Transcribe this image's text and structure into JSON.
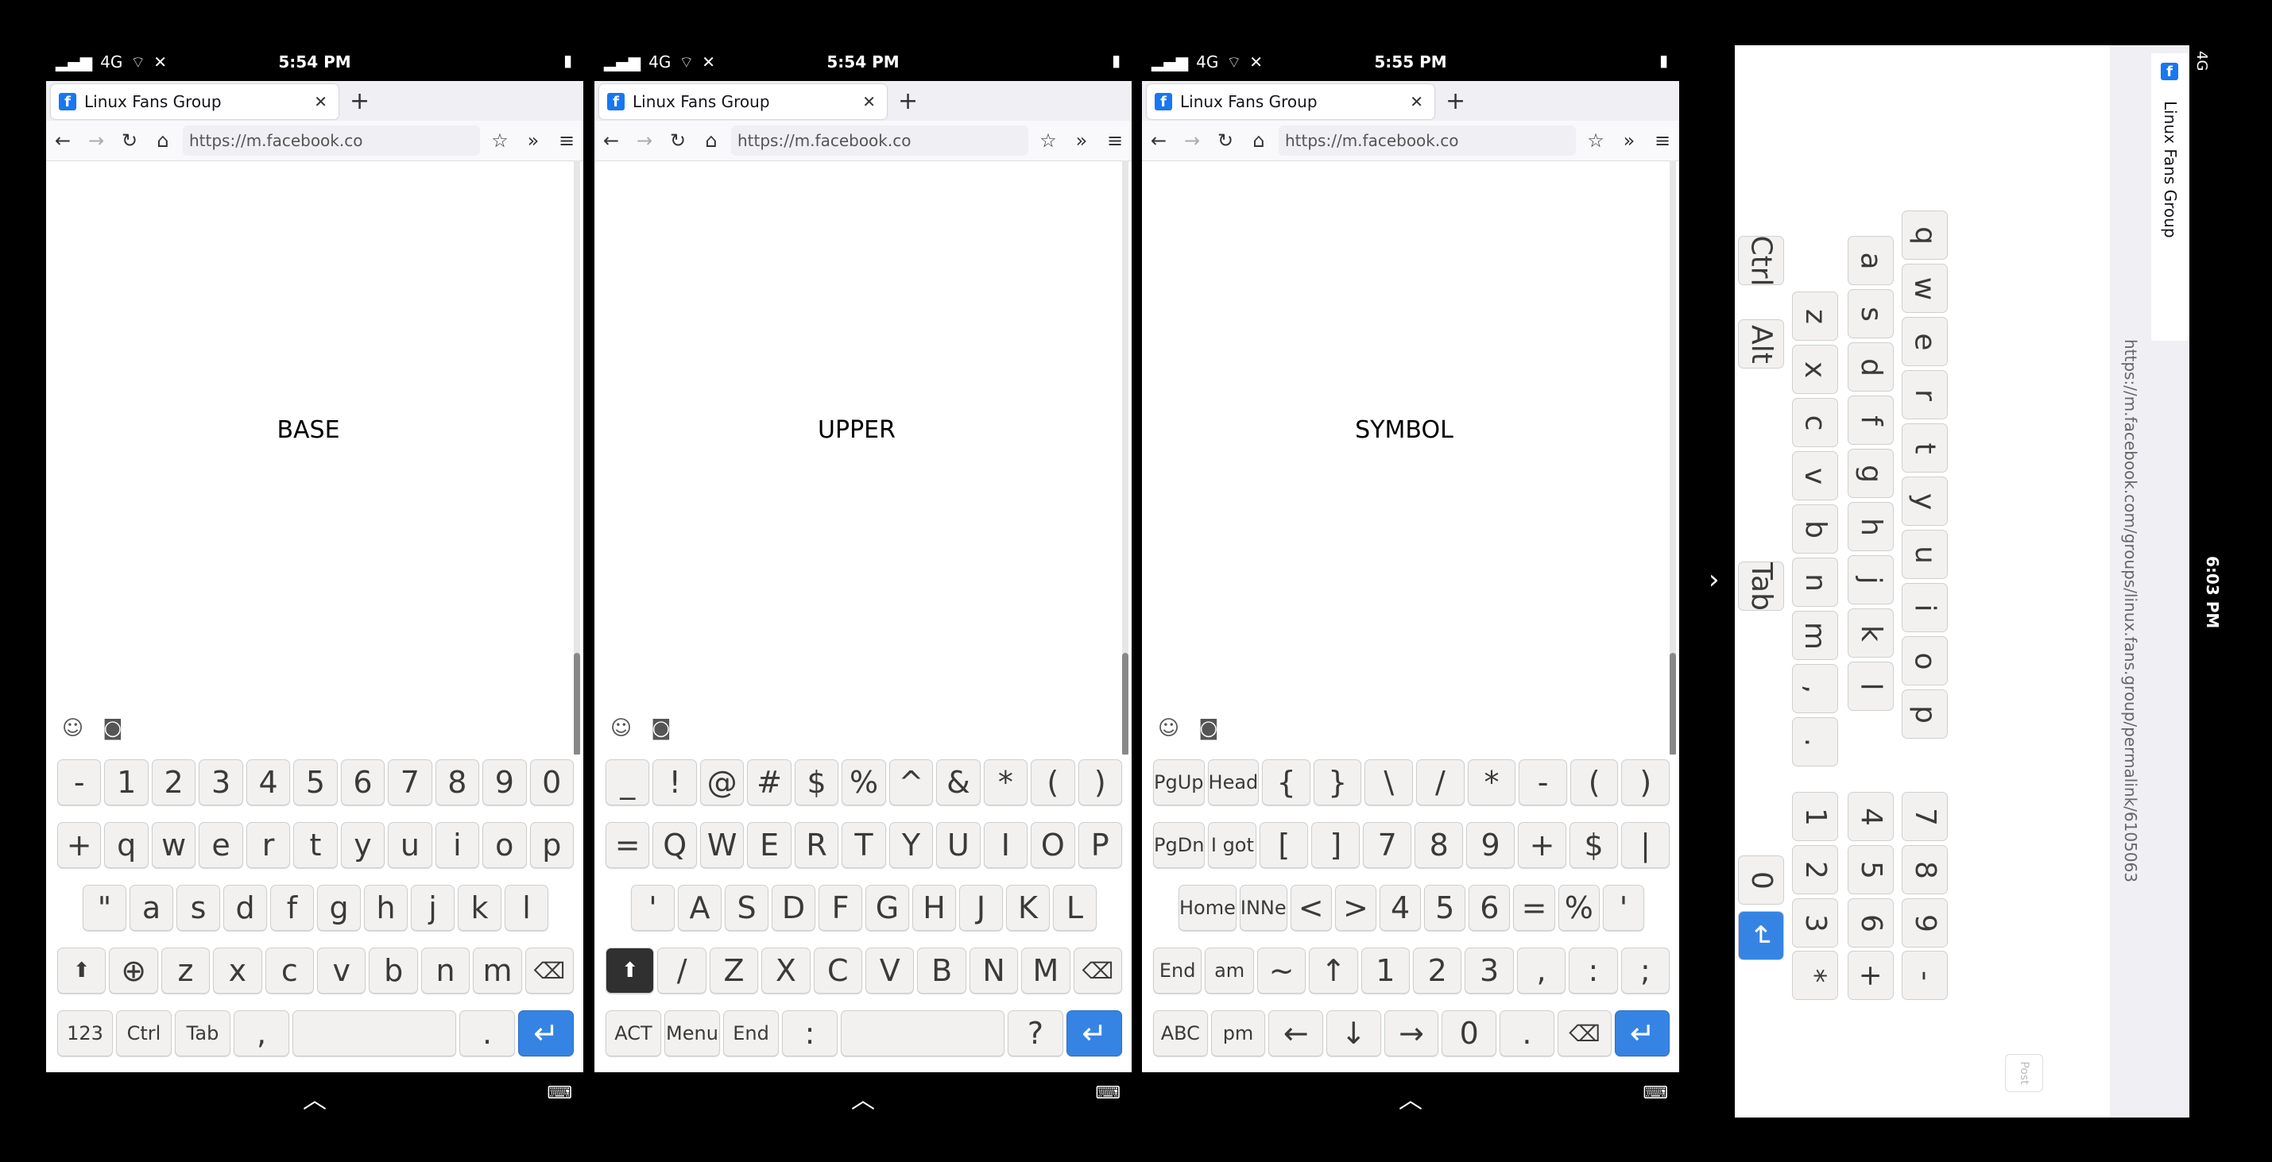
{
  "status": {
    "signal": "4G",
    "times": [
      "5:54 PM",
      "5:54 PM",
      "5:55 PM"
    ],
    "vertical_time": "6:03 PM"
  },
  "browser": {
    "tab_title": "Linux Fans Group",
    "url": "https://m.facebook.co",
    "url_full": "https://m.facebook.com/groups/linux.fans.group/permalink/6105063"
  },
  "layers": [
    "BASE",
    "UPPER",
    "SYMBOL"
  ],
  "keyboards": {
    "base": [
      [
        "-",
        "1",
        "2",
        "3",
        "4",
        "5",
        "6",
        "7",
        "8",
        "9",
        "0"
      ],
      [
        "+",
        "q",
        "w",
        "e",
        "r",
        "t",
        "y",
        "u",
        "i",
        "o",
        "p"
      ],
      [
        "\"",
        "a",
        "s",
        "d",
        "f",
        "g",
        "h",
        "j",
        "k",
        "l"
      ],
      [
        "⬆",
        "🌐",
        "z",
        "x",
        "c",
        "v",
        "b",
        "n",
        "m",
        "⌫"
      ],
      [
        "123",
        "Ctrl",
        "Tab",
        ",",
        "space",
        ".",
        "↵"
      ]
    ],
    "upper": [
      [
        "_",
        "!",
        "@",
        "#",
        "$",
        "%",
        "^",
        "&",
        "*",
        "(",
        ")"
      ],
      [
        "=",
        "Q",
        "W",
        "E",
        "R",
        "T",
        "Y",
        "U",
        "I",
        "O",
        "P"
      ],
      [
        "'",
        "A",
        "S",
        "D",
        "F",
        "G",
        "H",
        "J",
        "K",
        "L"
      ],
      [
        "⬆",
        "/",
        "Z",
        "X",
        "C",
        "V",
        "B",
        "N",
        "M",
        "⌫"
      ],
      [
        "ACT",
        "Menu",
        "End",
        ":",
        "space",
        "?",
        "↵"
      ]
    ],
    "symbol": [
      [
        "PgUp",
        "Head",
        "{",
        "}",
        "\\",
        "/",
        "*",
        "-",
        "(",
        ")"
      ],
      [
        "PgDn",
        "I got",
        "[",
        "]",
        "7",
        "8",
        "9",
        "+",
        "$",
        "|"
      ],
      [
        "Home",
        "INNe",
        "<",
        ">",
        "4",
        "5",
        "6",
        "=",
        "%",
        "'"
      ],
      [
        "End",
        "am",
        "~",
        "↑",
        "1",
        "2",
        "3",
        ",",
        ":",
        ";"
      ],
      [
        "ABC",
        "pm",
        "←",
        "↓",
        "→",
        "0",
        ".",
        "⌫",
        "↵"
      ]
    ]
  },
  "rotated": {
    "letters1": [
      "q",
      "w",
      "e",
      "r",
      "t",
      "y",
      "u",
      "i",
      "o",
      "p"
    ],
    "letters2": [
      "a",
      "s",
      "d",
      "f",
      "g",
      "h",
      "j",
      "k",
      "l"
    ],
    "letters3": [
      "z",
      "x",
      "c",
      "v",
      "b",
      "n",
      "m",
      ",",
      "."
    ],
    "mods": [
      "Ctrl",
      "Alt",
      "Tab"
    ],
    "numpad": [
      "7",
      "8",
      "9",
      "4",
      "5",
      "6",
      "1",
      "2",
      "3",
      "0",
      "*",
      "+",
      "-"
    ],
    "post": "Post"
  }
}
